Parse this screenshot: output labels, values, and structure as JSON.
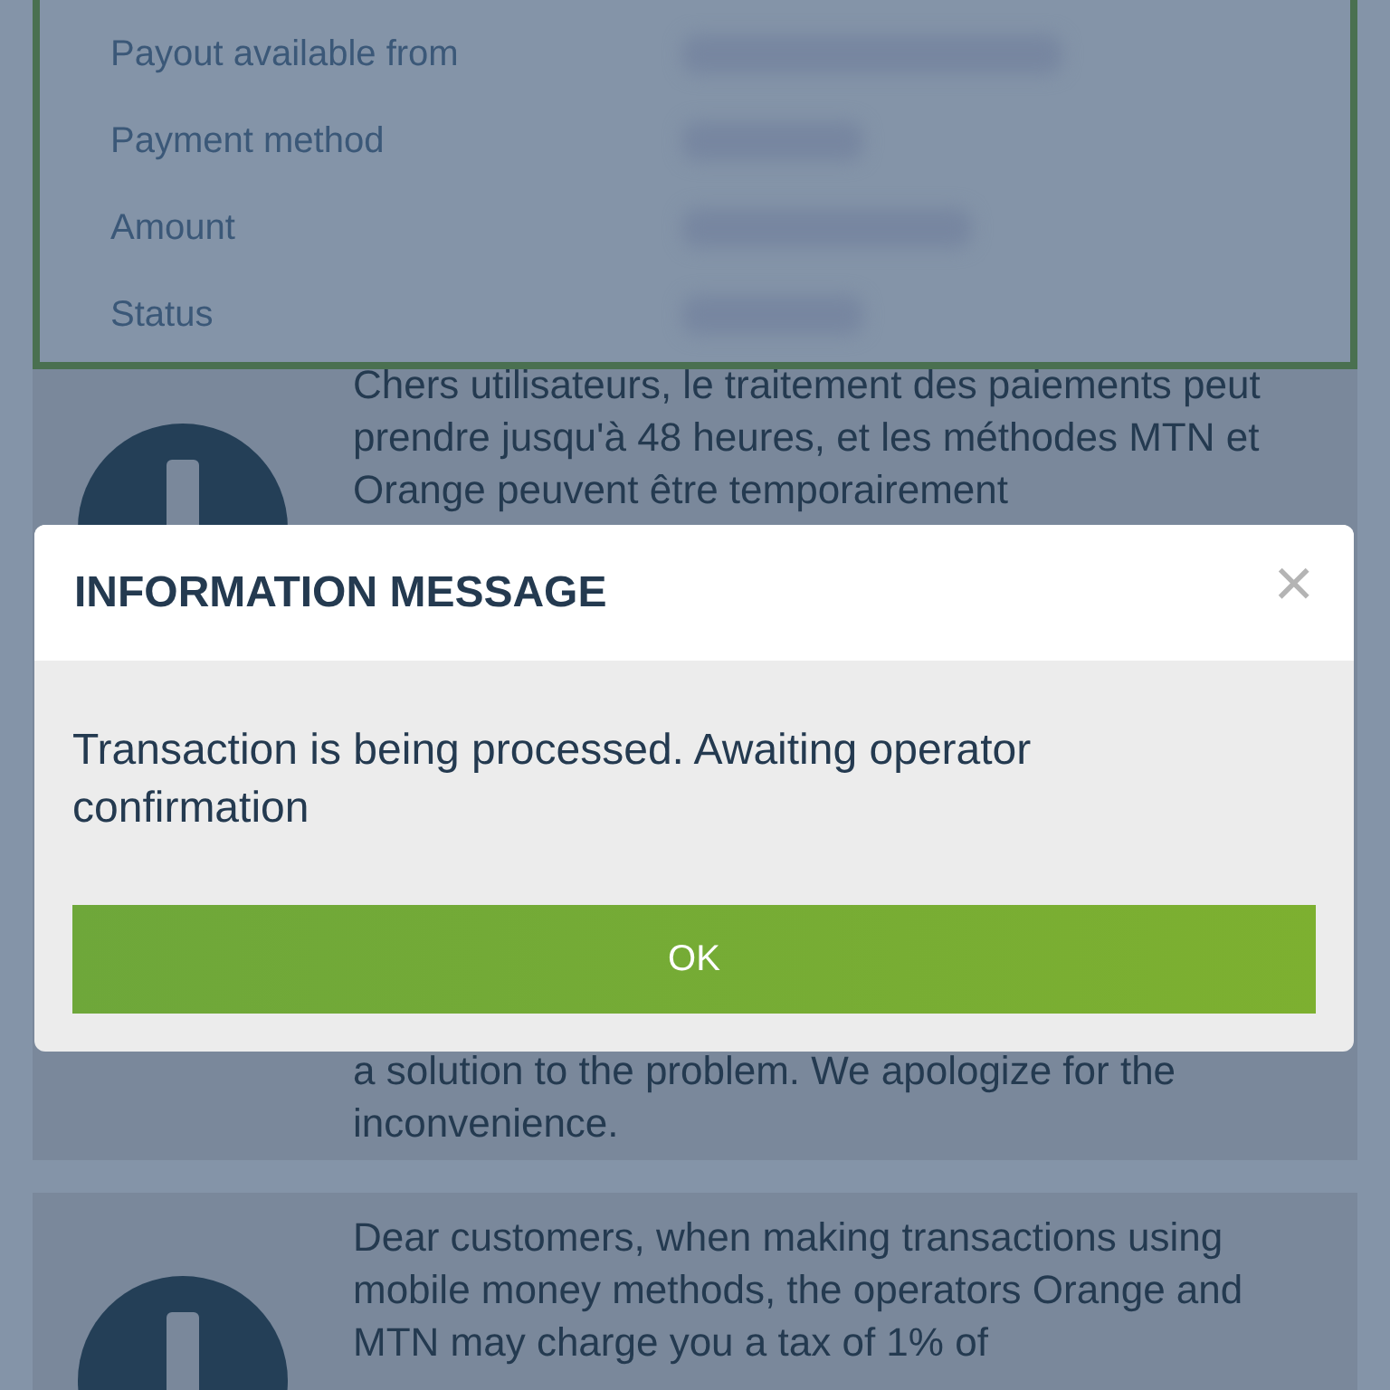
{
  "details": {
    "rows": [
      {
        "label": "Payout available from"
      },
      {
        "label": "Payment method"
      },
      {
        "label": "Amount"
      },
      {
        "label": "Status"
      }
    ]
  },
  "notices": [
    {
      "text_before": "Chers utilisateurs, le traitement des paiements peut prendre jusqu'à 48 heures, et les méthodes MTN et Orange peuvent être temporairement",
      "text_after": "a solution to the problem. We apologize for the inconvenience."
    },
    {
      "text_before": "Dear customers, when making transactions using mobile money methods, the operators Orange and MTN may charge you a tax of 1% of"
    }
  ],
  "dialog": {
    "title": "INFORMATION MESSAGE",
    "close": "×",
    "message": "Transaction is being processed. Awaiting operator confirmation",
    "button": "OK"
  }
}
